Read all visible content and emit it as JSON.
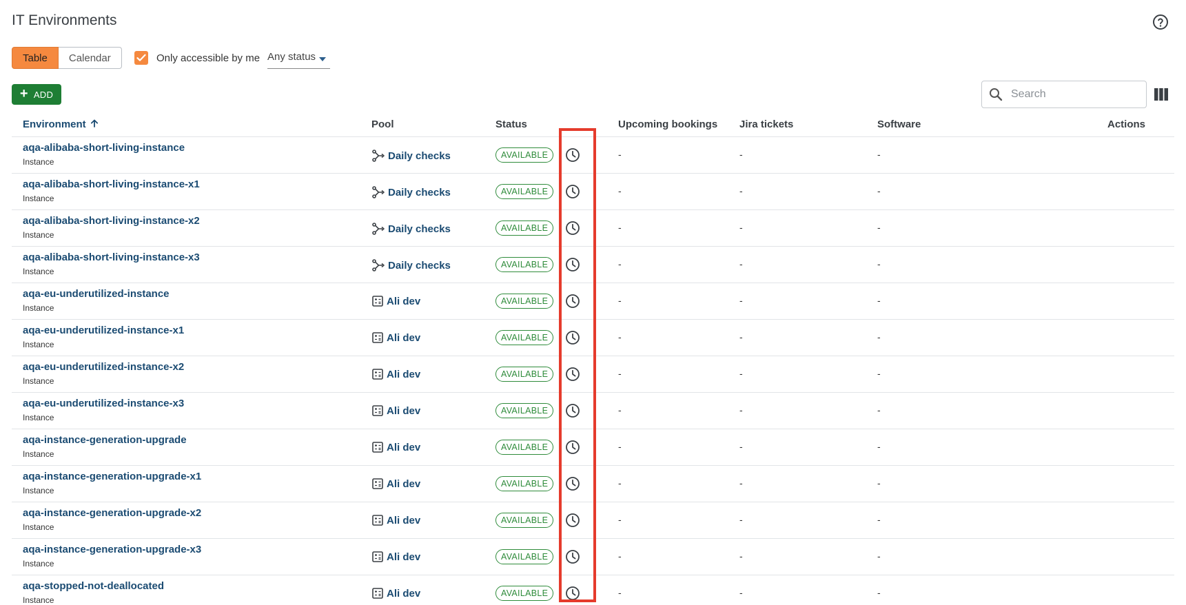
{
  "page": {
    "title": "IT Environments"
  },
  "view_toggle": {
    "table_label": "Table",
    "calendar_label": "Calendar",
    "active": "Table"
  },
  "filters": {
    "only_accessible_label": "Only accessible by me",
    "only_accessible_checked": true,
    "status_value": "Any status"
  },
  "toolbar": {
    "add_label": "ADD",
    "search_placeholder": "Search"
  },
  "table": {
    "columns": {
      "environment": "Environment",
      "pool": "Pool",
      "status": "Status",
      "upcoming": "Upcoming bookings",
      "jira": "Jira tickets",
      "software": "Software",
      "actions": "Actions"
    },
    "sort": {
      "column": "Environment",
      "direction": "ascending"
    },
    "rows": [
      {
        "name": "aqa-alibaba-short-living-instance",
        "type": "Instance",
        "pool_icon": "pool-tree-icon",
        "pool": "Daily checks",
        "status": "AVAILABLE",
        "upcoming": "-",
        "jira": "-",
        "software": "-"
      },
      {
        "name": "aqa-alibaba-short-living-instance-x1",
        "type": "Instance",
        "pool_icon": "pool-tree-icon",
        "pool": "Daily checks",
        "status": "AVAILABLE",
        "upcoming": "-",
        "jira": "-",
        "software": "-"
      },
      {
        "name": "aqa-alibaba-short-living-instance-x2",
        "type": "Instance",
        "pool_icon": "pool-tree-icon",
        "pool": "Daily checks",
        "status": "AVAILABLE",
        "upcoming": "-",
        "jira": "-",
        "software": "-"
      },
      {
        "name": "aqa-alibaba-short-living-instance-x3",
        "type": "Instance",
        "pool_icon": "pool-tree-icon",
        "pool": "Daily checks",
        "status": "AVAILABLE",
        "upcoming": "-",
        "jira": "-",
        "software": "-"
      },
      {
        "name": "aqa-eu-underutilized-instance",
        "type": "Instance",
        "pool_icon": "pool-calculator-icon",
        "pool": "Ali dev",
        "status": "AVAILABLE",
        "upcoming": "-",
        "jira": "-",
        "software": "-"
      },
      {
        "name": "aqa-eu-underutilized-instance-x1",
        "type": "Instance",
        "pool_icon": "pool-calculator-icon",
        "pool": "Ali dev",
        "status": "AVAILABLE",
        "upcoming": "-",
        "jira": "-",
        "software": "-"
      },
      {
        "name": "aqa-eu-underutilized-instance-x2",
        "type": "Instance",
        "pool_icon": "pool-calculator-icon",
        "pool": "Ali dev",
        "status": "AVAILABLE",
        "upcoming": "-",
        "jira": "-",
        "software": "-"
      },
      {
        "name": "aqa-eu-underutilized-instance-x3",
        "type": "Instance",
        "pool_icon": "pool-calculator-icon",
        "pool": "Ali dev",
        "status": "AVAILABLE",
        "upcoming": "-",
        "jira": "-",
        "software": "-"
      },
      {
        "name": "aqa-instance-generation-upgrade",
        "type": "Instance",
        "pool_icon": "pool-calculator-icon",
        "pool": "Ali dev",
        "status": "AVAILABLE",
        "upcoming": "-",
        "jira": "-",
        "software": "-"
      },
      {
        "name": "aqa-instance-generation-upgrade-x1",
        "type": "Instance",
        "pool_icon": "pool-calculator-icon",
        "pool": "Ali dev",
        "status": "AVAILABLE",
        "upcoming": "-",
        "jira": "-",
        "software": "-"
      },
      {
        "name": "aqa-instance-generation-upgrade-x2",
        "type": "Instance",
        "pool_icon": "pool-calculator-icon",
        "pool": "Ali dev",
        "status": "AVAILABLE",
        "upcoming": "-",
        "jira": "-",
        "software": "-"
      },
      {
        "name": "aqa-instance-generation-upgrade-x3",
        "type": "Instance",
        "pool_icon": "pool-calculator-icon",
        "pool": "Ali dev",
        "status": "AVAILABLE",
        "upcoming": "-",
        "jira": "-",
        "software": "-"
      },
      {
        "name": "aqa-stopped-not-deallocated",
        "type": "Instance",
        "pool_icon": "pool-calculator-icon",
        "pool": "Ali dev",
        "status": "AVAILABLE",
        "upcoming": "-",
        "jira": "-",
        "software": "-"
      }
    ]
  },
  "colors": {
    "accent": "#f5893f",
    "link": "#1b4b72",
    "success": "#2e8b3a",
    "add_button": "#1e7e34",
    "highlight": "#e53b2c"
  }
}
